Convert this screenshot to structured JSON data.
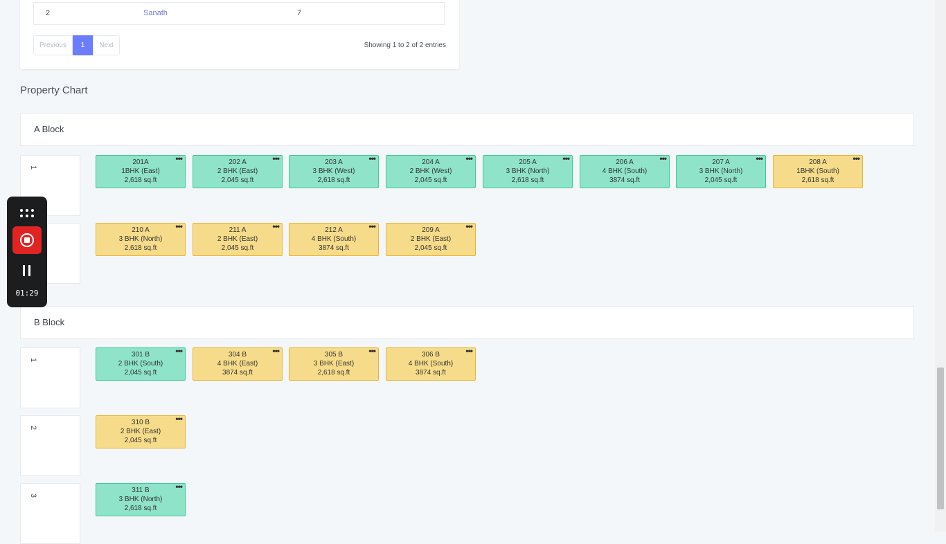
{
  "table": {
    "row": {
      "num": "2",
      "name": "Sanath",
      "value": "7"
    },
    "pager": {
      "previous": "Previous",
      "current": "1",
      "next": "Next"
    },
    "showing": "Showing 1 to 2 of 2 entries"
  },
  "section_title": "Property Chart",
  "blocks": [
    {
      "name": "A Block",
      "floors": [
        "1",
        ""
      ]
    },
    {
      "name": "B Block",
      "floors": [
        "1",
        "2",
        "3"
      ]
    }
  ],
  "units": {
    "a1": [
      {
        "id": "201A",
        "type": "1BHK (East)",
        "area": "2,618 sq.ft",
        "status": "available"
      },
      {
        "id": "202 A",
        "type": "2 BHK (East)",
        "area": "2,045 sq.ft",
        "status": "available"
      },
      {
        "id": "203 A",
        "type": "3 BHK (West)",
        "area": "2,618 sq.ft",
        "status": "available"
      },
      {
        "id": "204 A",
        "type": "2 BHK (West)",
        "area": "2,045 sq.ft",
        "status": "available"
      },
      {
        "id": "205 A",
        "type": "3 BHK (North)",
        "area": "2,618 sq.ft",
        "status": "available"
      },
      {
        "id": "206 A",
        "type": "4 BHK (South)",
        "area": "3874 sq.ft",
        "status": "available"
      },
      {
        "id": "207 A",
        "type": "3 BHK (North)",
        "area": "2,045 sq.ft",
        "status": "available"
      },
      {
        "id": "208 A",
        "type": "1BHK (South)",
        "area": "2,618 sq.ft",
        "status": "booked"
      }
    ],
    "a2": [
      {
        "id": "210 A",
        "type": "3 BHK (North)",
        "area": "2,618 sq.ft",
        "status": "booked"
      },
      {
        "id": "211 A",
        "type": "2 BHK (East)",
        "area": "2,045 sq.ft",
        "status": "booked"
      },
      {
        "id": "212 A",
        "type": "4 BHK (South)",
        "area": "3874 sq.ft",
        "status": "booked"
      },
      {
        "id": "209 A",
        "type": "2 BHK (East)",
        "area": "2,045 sq.ft",
        "status": "booked"
      }
    ],
    "b1": [
      {
        "id": "301 B",
        "type": "2 BHK (South)",
        "area": "2,045 sq.ft",
        "status": "available"
      },
      {
        "id": "304 B",
        "type": "4 BHK (East)",
        "area": "3874 sq.ft",
        "status": "booked"
      },
      {
        "id": "305 B",
        "type": "3 BHK (East)",
        "area": "2,618 sq.ft",
        "status": "booked"
      },
      {
        "id": "306 B",
        "type": "4 BHK (South)",
        "area": "3874 sq.ft",
        "status": "booked"
      }
    ],
    "b2": [
      {
        "id": "310 B",
        "type": "2 BHK (East)",
        "area": "2,045 sq.ft",
        "status": "booked"
      }
    ],
    "b3": [
      {
        "id": "311 B",
        "type": "3 BHK (North)",
        "area": "2,618 sq.ft",
        "status": "available"
      }
    ]
  },
  "unit_menu_glyph": "•••",
  "recorder": {
    "time": "01:29"
  },
  "colors": {
    "available": "#8ee3c8",
    "booked": "#f6dc8a",
    "accent": "#6c7cff",
    "record": "#e02424"
  }
}
